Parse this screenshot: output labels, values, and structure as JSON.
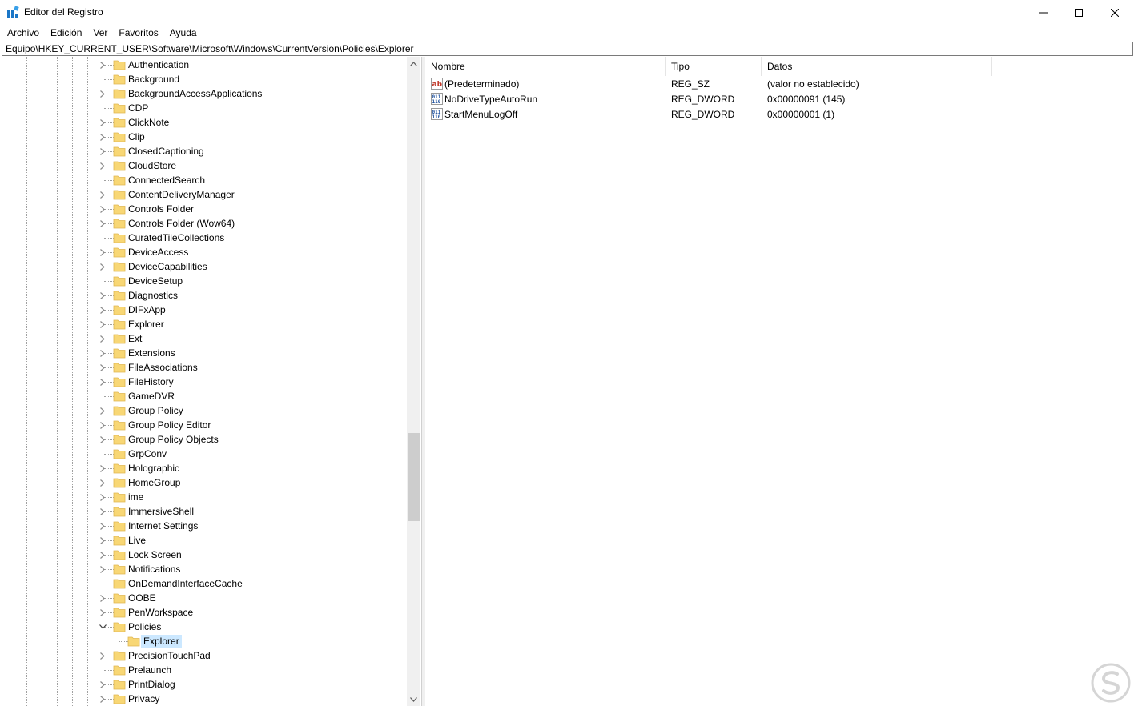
{
  "window": {
    "title": "Editor del Registro"
  },
  "menu": [
    "Archivo",
    "Edición",
    "Ver",
    "Favoritos",
    "Ayuda"
  ],
  "address": "Equipo\\HKEY_CURRENT_USER\\Software\\Microsoft\\Windows\\CurrentVersion\\Policies\\Explorer",
  "tree": {
    "items": [
      {
        "label": "Authentication",
        "expandable": true
      },
      {
        "label": "Background",
        "expandable": false
      },
      {
        "label": "BackgroundAccessApplications",
        "expandable": true
      },
      {
        "label": "CDP",
        "expandable": false
      },
      {
        "label": "ClickNote",
        "expandable": true
      },
      {
        "label": "Clip",
        "expandable": true
      },
      {
        "label": "ClosedCaptioning",
        "expandable": true
      },
      {
        "label": "CloudStore",
        "expandable": true
      },
      {
        "label": "ConnectedSearch",
        "expandable": false
      },
      {
        "label": "ContentDeliveryManager",
        "expandable": true
      },
      {
        "label": "Controls Folder",
        "expandable": true
      },
      {
        "label": "Controls Folder (Wow64)",
        "expandable": true
      },
      {
        "label": "CuratedTileCollections",
        "expandable": false
      },
      {
        "label": "DeviceAccess",
        "expandable": true
      },
      {
        "label": "DeviceCapabilities",
        "expandable": true
      },
      {
        "label": "DeviceSetup",
        "expandable": false
      },
      {
        "label": "Diagnostics",
        "expandable": true
      },
      {
        "label": "DIFxApp",
        "expandable": true
      },
      {
        "label": "Explorer",
        "expandable": true
      },
      {
        "label": "Ext",
        "expandable": true
      },
      {
        "label": "Extensions",
        "expandable": true
      },
      {
        "label": "FileAssociations",
        "expandable": true
      },
      {
        "label": "FileHistory",
        "expandable": true
      },
      {
        "label": "GameDVR",
        "expandable": false
      },
      {
        "label": "Group Policy",
        "expandable": true
      },
      {
        "label": "Group Policy Editor",
        "expandable": true
      },
      {
        "label": "Group Policy Objects",
        "expandable": true
      },
      {
        "label": "GrpConv",
        "expandable": false
      },
      {
        "label": "Holographic",
        "expandable": true
      },
      {
        "label": "HomeGroup",
        "expandable": true
      },
      {
        "label": "ime",
        "expandable": true
      },
      {
        "label": "ImmersiveShell",
        "expandable": true
      },
      {
        "label": "Internet Settings",
        "expandable": true
      },
      {
        "label": "Live",
        "expandable": true
      },
      {
        "label": "Lock Screen",
        "expandable": true
      },
      {
        "label": "Notifications",
        "expandable": true
      },
      {
        "label": "OnDemandInterfaceCache",
        "expandable": false
      },
      {
        "label": "OOBE",
        "expandable": true
      },
      {
        "label": "PenWorkspace",
        "expandable": true
      },
      {
        "label": "Policies",
        "expandable": true,
        "expanded": true
      },
      {
        "label": "Explorer",
        "expandable": false,
        "child": true,
        "selected": true
      },
      {
        "label": "PrecisionTouchPad",
        "expandable": true
      },
      {
        "label": "Prelaunch",
        "expandable": false
      },
      {
        "label": "PrintDialog",
        "expandable": true
      },
      {
        "label": "Privacy",
        "expandable": true
      }
    ]
  },
  "values": {
    "headers": {
      "name": "Nombre",
      "type": "Tipo",
      "data": "Datos"
    },
    "rows": [
      {
        "name": "(Predeterminado)",
        "type": "REG_SZ",
        "data": "(valor no establecido)",
        "icon": "string-value-icon"
      },
      {
        "name": "NoDriveTypeAutoRun",
        "type": "REG_DWORD",
        "data": "0x00000091 (145)",
        "icon": "binary-value-icon"
      },
      {
        "name": "StartMenuLogOff",
        "type": "REG_DWORD",
        "data": "0x00000001 (1)",
        "icon": "binary-value-icon"
      }
    ]
  },
  "colors": {
    "folder": "#f8d775",
    "selection": "#cce8ff",
    "scroll_thumb": "#cdcdcd"
  }
}
